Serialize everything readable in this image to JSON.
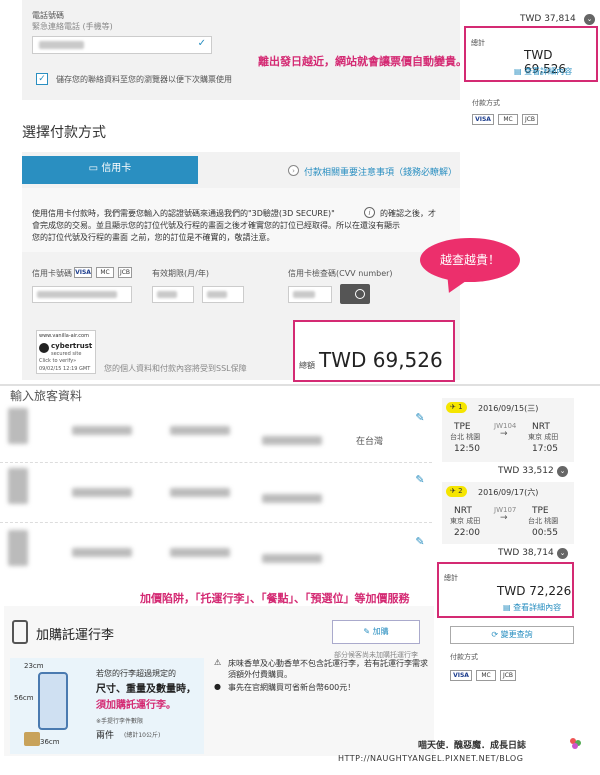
{
  "contact": {
    "phone_label": "電話號碼",
    "phone_sub": "緊急連絡電話 (手機等)",
    "save_label": "儲存您的聯絡資料至您的瀏覽器以便下次購票使用"
  },
  "payment": {
    "title": "選擇付款方式",
    "tab_credit": "信用卡",
    "notice": "付款相關重要注意事項（錢務必瞭解）",
    "desc_line1": "使用信用卡付款時，我們需要您輸入的認證號碼來通過我們的\"3D驗證(3D SECURE)\"",
    "desc_line1b": "的確認之後，才",
    "desc_line2": "會完成您的交易。並且顯示您的訂位代號及行程的畫面之後才確實您的訂位已經取得。所以在還沒有顯示",
    "desc_line3": "您的訂位代號及行程的畫面 之前，您的訂位是不確實的，敬請注意。",
    "card_number_label": "信用卡號碼",
    "expiry_label": "有效期限(月/年)",
    "cvv_label": "信用卡檢查碼(CVV number)",
    "card_visa": "VISA",
    "card_mc": "MC",
    "card_jcb": "JCB",
    "ssl_note": "您的個人資料和付款內容將受到SSL保障",
    "verisign_site": "www.vanilla-air.com",
    "cybertrust": "cybertrust",
    "cybertrust_sub": "secured site",
    "verify": "Click to verify»",
    "verify_date": "09/02/15 12:19 GMT"
  },
  "summary_top": {
    "prev_amount": "TWD 37,814",
    "total_label": "總計",
    "total_amount": "TWD 69,526",
    "details_link": "查看詳細內容",
    "payment_method_label": "付款方式"
  },
  "total_box": {
    "label": "總額",
    "amount": "TWD 69,526"
  },
  "annotations": {
    "top_note": "離出發日越近，網站就會讓票價自動變貴。",
    "bubble": "越查越貴！",
    "bottom_note": "加價陷阱，「托運行李」、「餐點」、「預選位」等加價服務"
  },
  "passengers": {
    "header": "輸入旅客資料",
    "nationality_text": "在台灣"
  },
  "flights": [
    {
      "seg": "1",
      "date": "2016/09/15(三)",
      "from_code": "TPE",
      "from_name": "台北 桃園",
      "dep": "12:50",
      "flight_no": "JW104",
      "to_code": "NRT",
      "to_name": "東京 成田",
      "arr": "17:05",
      "price": "TWD 33,512"
    },
    {
      "seg": "2",
      "date": "2016/09/17(六)",
      "from_code": "NRT",
      "from_name": "東京 成田",
      "dep": "22:00",
      "flight_no": "JW107",
      "to_code": "TPE",
      "to_name": "台北 桃園",
      "arr": "00:55",
      "price": "TWD 38,714"
    }
  ],
  "summary_bottom": {
    "total_label": "總計",
    "total_amount": "TWD 72,226",
    "details_link": "查看詳細內容",
    "change_button": "變更查詢",
    "payment_method_label": "付款方式"
  },
  "luggage": {
    "title": "加購託運行李",
    "add_button": "加購",
    "note_top": "部分候客尚未加購托運行李",
    "heading1": "若您的行李超過規定的",
    "heading2": "尺寸、重量及數量時，",
    "heading3": "須加購託運行李。",
    "carry_label": "※手提行李件數限",
    "carry_count": "兩件",
    "carry_weight": "(總計10公斤)",
    "dim_h": "23cm",
    "dim_v": "56cm",
    "dim_w": "36cm",
    "bullet1": "床味香草及心動香草不包含託運行李，若有託運行李需求須額外付費購買。",
    "bullet2": "事先在官網購買可省新台幣600元！"
  },
  "watermark": {
    "line1": "喵天使．醜惡魔．成長日誌",
    "line2": "HTTP://NAUGHTYANGEL.PIXNET.NET/BLOG"
  },
  "colors": {
    "accent": "#2a8fc1",
    "highlight": "#d42a73",
    "bubble": "#ec2f6c"
  }
}
